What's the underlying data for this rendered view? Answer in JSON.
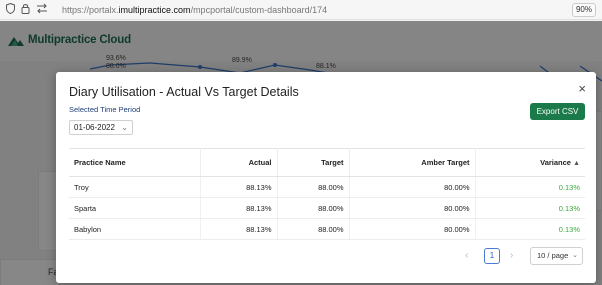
{
  "browser": {
    "url_prefix": "https://portalx.",
    "url_host": "imultipractice.com",
    "url_path": "/mpcportal/custom-dashboard/174",
    "zoom": "90%"
  },
  "app": {
    "logo_text": "Multipractice Cloud",
    "bg_values": [
      "93.6%",
      "88.0%",
      "89.9%",
      "88.1%"
    ],
    "bg_side_label": "Fa"
  },
  "modal": {
    "title": "Diary Utilisation - Actual Vs Target Details",
    "close_symbol": "×",
    "period_label": "Selected Time Period",
    "date_value": "01-06-2022",
    "export_label": "Export CSV",
    "columns": [
      "Practice Name",
      "Actual",
      "Target",
      "Amber Target",
      "Variance"
    ],
    "rows": [
      {
        "name": "Troy",
        "actual": "88.13%",
        "target": "88.00%",
        "amber": "80.00%",
        "variance": "0.13%"
      },
      {
        "name": "Sparta",
        "actual": "88.13%",
        "target": "88.00%",
        "amber": "80.00%",
        "variance": "0.13%"
      },
      {
        "name": "Babylon",
        "actual": "88.13%",
        "target": "88.00%",
        "amber": "80.00%",
        "variance": "0.13%"
      }
    ],
    "pagination": {
      "current_page": "1",
      "page_size": "10 / page"
    }
  },
  "colors": {
    "primary_green": "#1a7a4a",
    "variance_green": "#3ca93c",
    "page_blue": "#4a7bd6"
  }
}
